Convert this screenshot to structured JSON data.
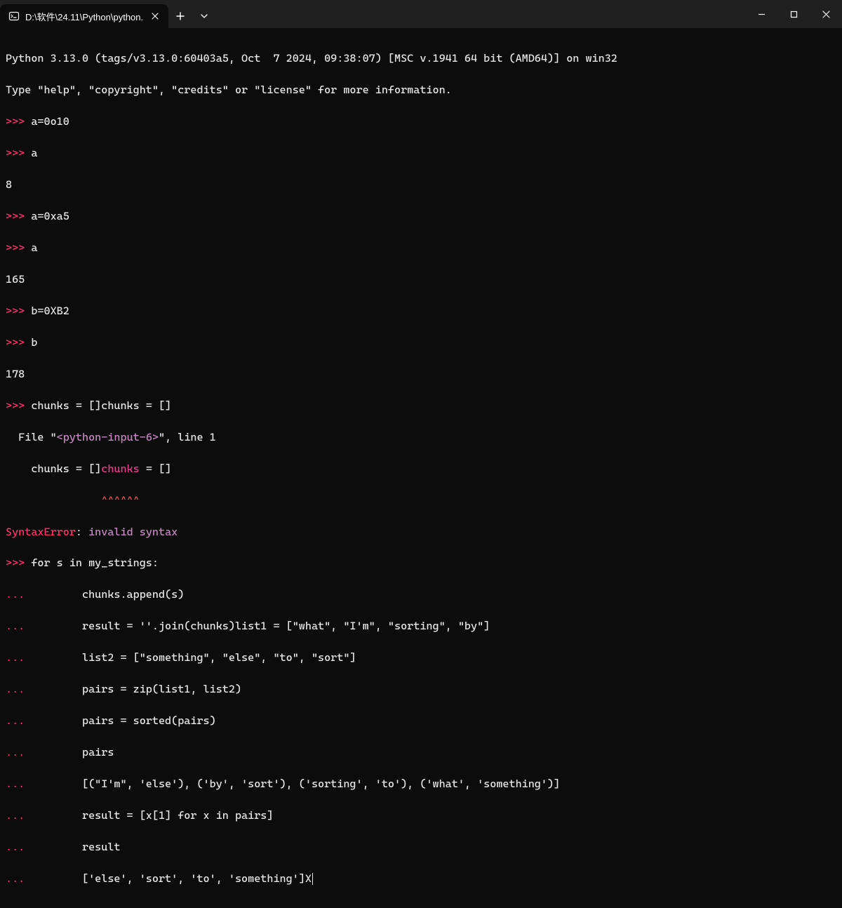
{
  "titlebar": {
    "tab_title": "D:\\软件\\24.11\\Python\\python."
  },
  "term": {
    "banner1": "Python 3.13.0 (tags/v3.13.0:60403a5, Oct  7 2024, 09:38:07) [MSC v.1941 64 bit (AMD64)] on win32",
    "banner2": "Type \"help\", \"copyright\", \"credits\" or \"license\" for more information.",
    "p1": ">>> ",
    "c1": "a=0o10",
    "p2": ">>> ",
    "c2": "a",
    "o1": "8",
    "p3": ">>> ",
    "c3": "a=0xa5",
    "p4": ">>> ",
    "c4": "a",
    "o2": "165",
    "p5": ">>> ",
    "c5": "b=0XB2",
    "p6": ">>> ",
    "c6": "b",
    "o3": "178",
    "p7": ">>> ",
    "c7": "chunks = []chunks = []",
    "err_file_pre": "  File ",
    "err_file_q1": "\"",
    "err_file_name": "<python-input-6>",
    "err_file_q2": "\"",
    "err_file_post": ", line 1",
    "err_echo_pre": "    chunks = []",
    "err_echo_kw": "chunks",
    "err_echo_post": " = []",
    "err_carets": "               ^^^^^^",
    "err_name": "SyntaxError",
    "err_colon": ": ",
    "err_msg": "invalid syntax",
    "p8": ">>> ",
    "c8": "for s in my_strings:",
    "dot": "... ",
    "cont1": "        chunks.append(s)",
    "cont2": "        result = ''.join(chunks)list1 = [\"what\", \"I'm\", \"sorting\", \"by\"]",
    "cont3": "        list2 = [\"something\", \"else\", \"to\", \"sort\"]",
    "cont4": "        pairs = zip(list1, list2)",
    "cont5": "        pairs = sorted(pairs)",
    "cont6": "        pairs",
    "cont7": "        [(\"I'm\", 'else'), ('by', 'sort'), ('sorting', 'to'), ('what', 'something')]",
    "cont8": "        result = [x[1] for x in pairs]",
    "cont9": "        result",
    "cont10": "        ['else', 'sort', 'to', 'something']X"
  }
}
